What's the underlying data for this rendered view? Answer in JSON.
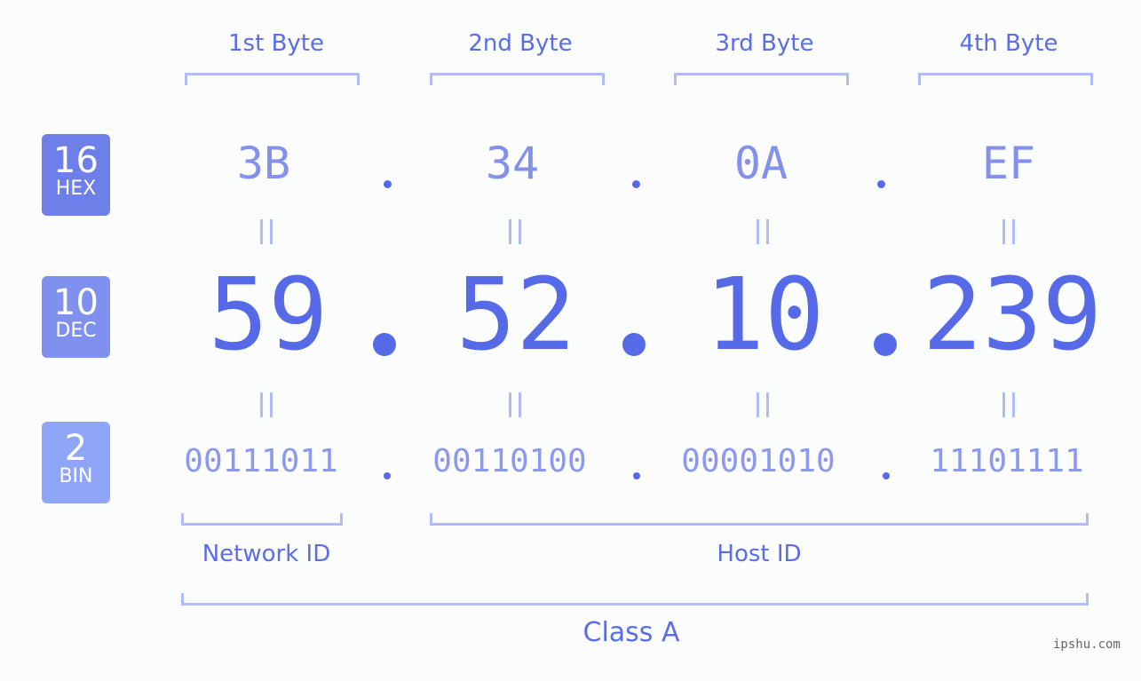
{
  "bytes": [
    {
      "label": "1st Byte",
      "hex": "3B",
      "dec": "59",
      "bin": "00111011"
    },
    {
      "label": "2nd Byte",
      "hex": "34",
      "dec": "52",
      "bin": "00110100"
    },
    {
      "label": "3rd Byte",
      "hex": "0A",
      "dec": "10",
      "bin": "00001010"
    },
    {
      "label": "4th Byte",
      "hex": "EF",
      "dec": "239",
      "bin": "11101111"
    }
  ],
  "badges": {
    "hex": {
      "num": "16",
      "name": "HEX",
      "color": "#6f7fea"
    },
    "dec": {
      "num": "10",
      "name": "DEC",
      "color": "#8090ef"
    },
    "bin": {
      "num": "2",
      "name": "BIN",
      "color": "#8fa5f7"
    }
  },
  "segments": {
    "network": "Network ID",
    "host": "Host ID",
    "class": "Class A"
  },
  "watermark": "ipshu.com",
  "colors": {
    "primary": "#566ae8",
    "bracket": "#b1bcf6",
    "background": "#fbfdfc"
  }
}
